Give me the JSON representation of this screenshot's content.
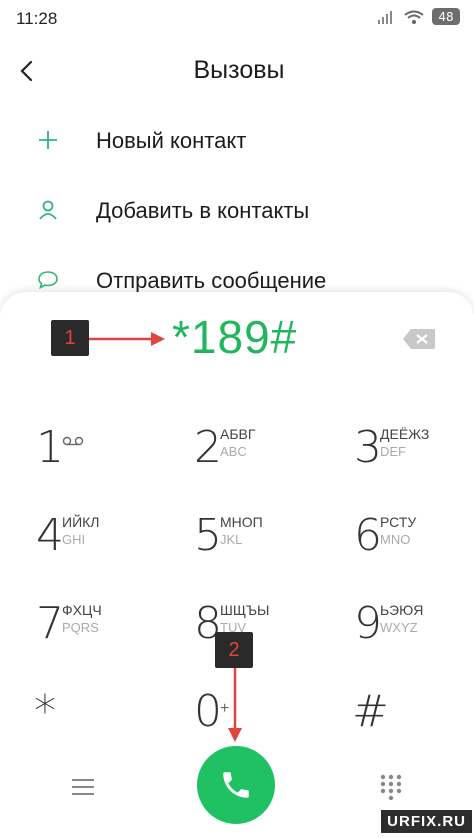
{
  "status_bar": {
    "time": "11:28",
    "battery": "48"
  },
  "header": {
    "title": "Вызовы"
  },
  "menu": [
    {
      "label": "Новый контакт",
      "icon": "plus-icon"
    },
    {
      "label": "Добавить в контакты",
      "icon": "person-icon"
    },
    {
      "label": "Отправить сообщение",
      "icon": "message-icon"
    }
  ],
  "dialer": {
    "number": "*189#"
  },
  "annotations": {
    "first": "1",
    "second": "2"
  },
  "keys": [
    {
      "digit": "1",
      "line1": "",
      "line2": ""
    },
    {
      "digit": "2",
      "line1": "АБВГ",
      "line2": "ABC"
    },
    {
      "digit": "3",
      "line1": "ДЕЁЖЗ",
      "line2": "DEF"
    },
    {
      "digit": "4",
      "line1": "ИЙКЛ",
      "line2": "GHI"
    },
    {
      "digit": "5",
      "line1": "МНОП",
      "line2": "JKL"
    },
    {
      "digit": "6",
      "line1": "РСТУ",
      "line2": "MNO"
    },
    {
      "digit": "7",
      "line1": "ФХЦЧ",
      "line2": "PQRS"
    },
    {
      "digit": "8",
      "line1": "ШЩЪЫ",
      "line2": "TUV"
    },
    {
      "digit": "9",
      "line1": "ЬЭЮЯ",
      "line2": "WXYZ"
    },
    {
      "digit": "*",
      "line1": "",
      "line2": ""
    },
    {
      "digit": "0",
      "line1": "+",
      "line2": ""
    },
    {
      "digit": "#",
      "line1": "",
      "line2": ""
    }
  ],
  "colors": {
    "accent": "#1fb75c",
    "call_button": "#1fc162",
    "annotation_text": "#e0463c"
  },
  "watermark": "URFIX.RU"
}
